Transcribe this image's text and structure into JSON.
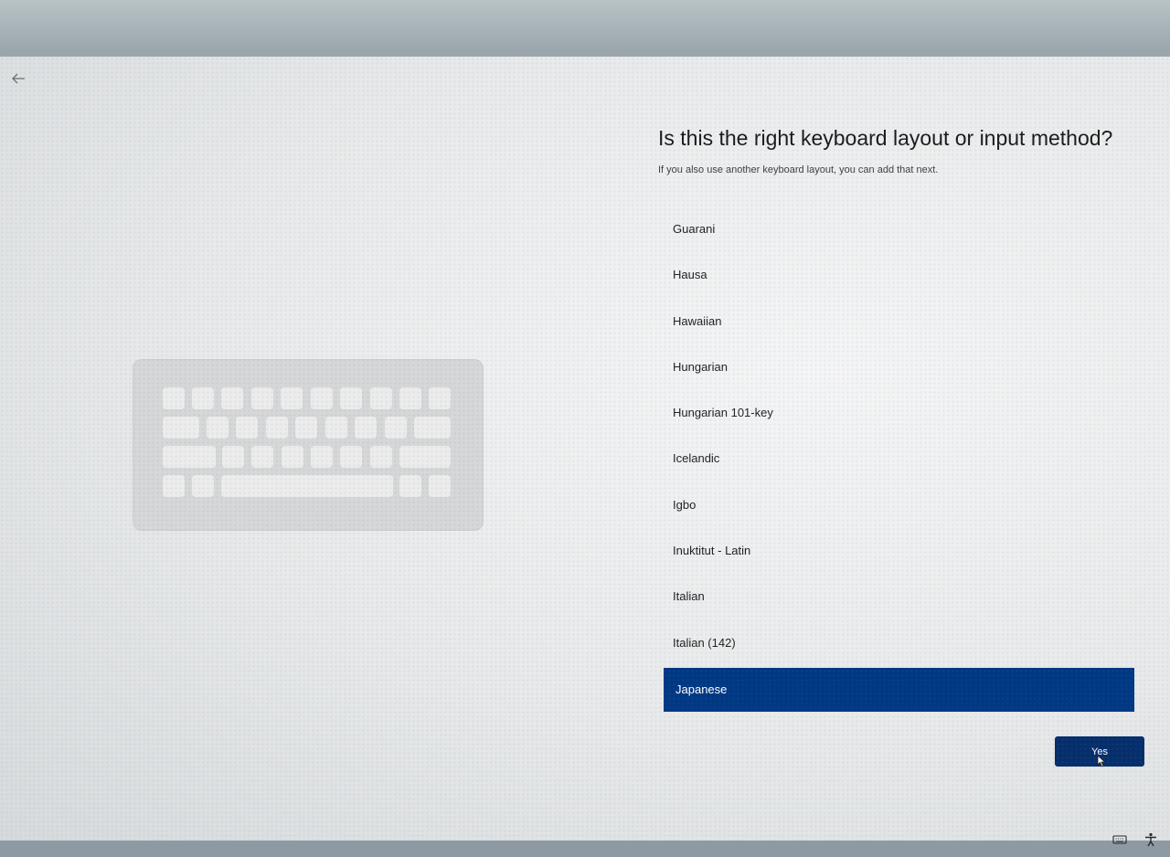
{
  "header": {
    "title": "Is this the right keyboard layout or input method?",
    "subtitle": "If you also use another keyboard layout, you can add that next."
  },
  "layouts": {
    "items": [
      {
        "label": "Guarani",
        "selected": false
      },
      {
        "label": "Hausa",
        "selected": false
      },
      {
        "label": "Hawaiian",
        "selected": false
      },
      {
        "label": "Hungarian",
        "selected": false
      },
      {
        "label": "Hungarian 101-key",
        "selected": false
      },
      {
        "label": "Icelandic",
        "selected": false
      },
      {
        "label": "Igbo",
        "selected": false
      },
      {
        "label": "Inuktitut - Latin",
        "selected": false
      },
      {
        "label": "Italian",
        "selected": false
      },
      {
        "label": "Italian (142)",
        "selected": false
      },
      {
        "label": "Japanese",
        "selected": true
      }
    ]
  },
  "actions": {
    "yes_label": "Yes"
  },
  "icons": {
    "back": "arrow-left-icon",
    "keyboard": "keyboard-icon",
    "accessibility": "accessibility-icon"
  },
  "colors": {
    "selected_bg": "#003884",
    "button_bg": "#052e6c"
  }
}
